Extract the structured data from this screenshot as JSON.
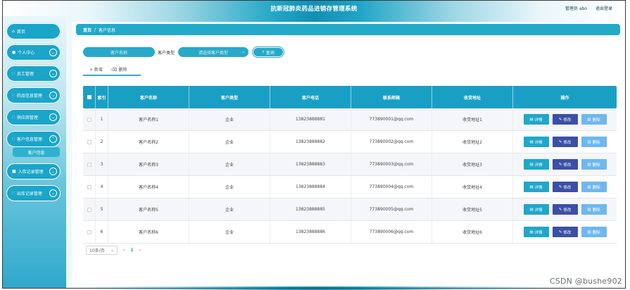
{
  "app": {
    "title": "抗新冠肺炎药品进销存管理系统",
    "user_label": "管理员 abo",
    "logout_label": "退出登录"
  },
  "sidebar": {
    "items": [
      {
        "icon": "home-icon",
        "label": "首页",
        "glyph": "⌂"
      },
      {
        "icon": "person-icon",
        "label": "个人中心",
        "glyph": "👤"
      },
      {
        "icon": "grid-icon",
        "label": "员工管理",
        "glyph": "∷"
      },
      {
        "icon": "grid-icon",
        "label": "药品信息管理",
        "glyph": "∷"
      },
      {
        "icon": "grid-icon",
        "label": "供应商管理",
        "glyph": "∷"
      },
      {
        "icon": "grid-icon",
        "label": "客户信息管理",
        "glyph": "∷"
      },
      {
        "icon": "lock-icon",
        "label": "入库记录管理",
        "glyph": "■"
      },
      {
        "icon": "grid-icon",
        "label": "出库记录管理",
        "glyph": "∷"
      }
    ],
    "active_sub": "客户信息"
  },
  "breadcrumb": {
    "home": "首页",
    "sep": "/",
    "current": "客户信息"
  },
  "search": {
    "name_placeholder": "客户名称",
    "type_label": "客户类型",
    "type_placeholder": "请选择客户类型",
    "query_label": "查询"
  },
  "actions": {
    "add": "+ 新增",
    "delete": "删除"
  },
  "table": {
    "headers": [
      "索引",
      "客户名称",
      "客户类型",
      "客户电话",
      "联系邮箱",
      "收货地址",
      "操作"
    ],
    "rows": [
      {
        "index": "1",
        "name": "客户名称1",
        "type": "企业",
        "phone": "13823888881",
        "email": "773890001@qq.com",
        "address": "收货地址1"
      },
      {
        "index": "2",
        "name": "客户名称2",
        "type": "企业",
        "phone": "13823888882",
        "email": "773890002@qq.com",
        "address": "收货地址2"
      },
      {
        "index": "3",
        "name": "客户名称3",
        "type": "企业",
        "phone": "13823888883",
        "email": "773890003@qq.com",
        "address": "收货地址3"
      },
      {
        "index": "4",
        "name": "客户名称4",
        "type": "企业",
        "phone": "13823888884",
        "email": "773890004@qq.com",
        "address": "收货地址4"
      },
      {
        "index": "5",
        "name": "客户名称5",
        "type": "企业",
        "phone": "13823888885",
        "email": "773890005@qq.com",
        "address": "收货地址5"
      },
      {
        "index": "6",
        "name": "客户名称6",
        "type": "企业",
        "phone": "13823888886",
        "email": "773890006@qq.com",
        "address": "收货地址6"
      }
    ],
    "btn_detail": "详情",
    "btn_edit": "修改",
    "btn_delete": "删除"
  },
  "pager": {
    "page_size": "10条/页",
    "prev": "‹",
    "current": "1",
    "next": "›"
  },
  "watermark": "CSDN @bushe902",
  "colors": {
    "accent": "#1aa5c9",
    "edit": "#3c4fa6",
    "delete": "#6fb7f0"
  }
}
